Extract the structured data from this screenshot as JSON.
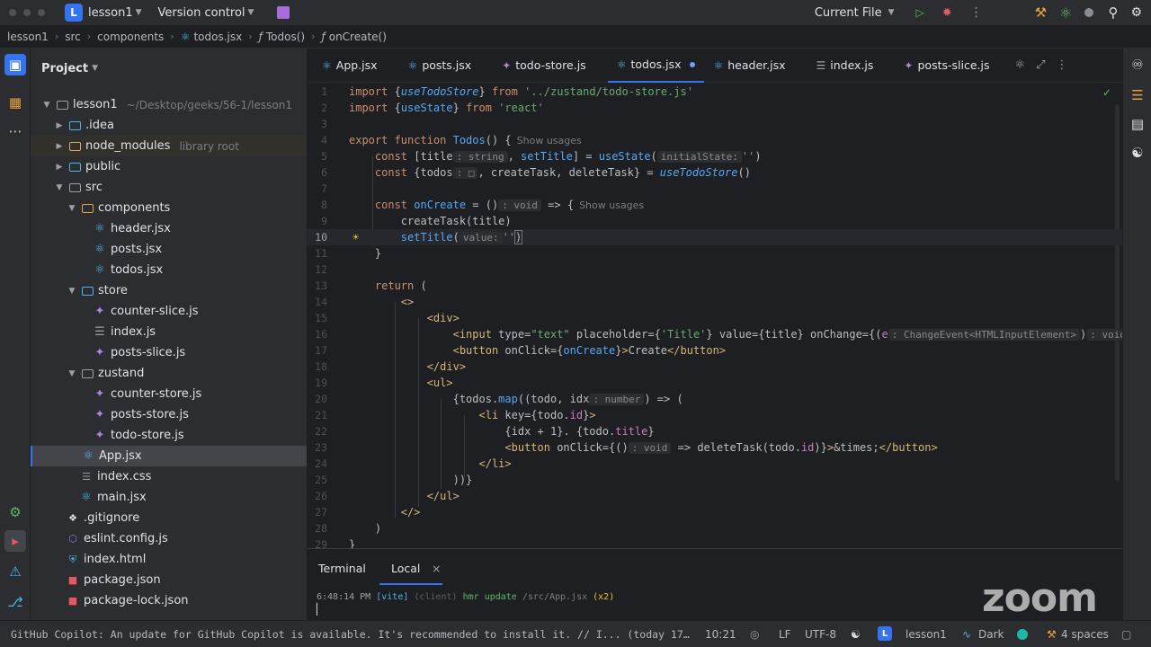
{
  "titlebar": {
    "project_badge": "L",
    "project_name": "lesson1",
    "vcs": "Version control",
    "run_config": "Current File"
  },
  "breadcrumb": [
    "lesson1",
    "src",
    "components",
    "todos.jsx",
    "Todos()",
    "onCreate()"
  ],
  "project_panel": {
    "title": "Project",
    "root": {
      "name": "lesson1",
      "path": "~/Desktop/geeks/56-1/lesson1"
    },
    "library_hint": "library root",
    "items": [
      {
        "name": ".idea"
      },
      {
        "name": "node_modules"
      },
      {
        "name": "public"
      },
      {
        "name": "src"
      },
      {
        "name": "components"
      },
      {
        "name": "header.jsx"
      },
      {
        "name": "posts.jsx"
      },
      {
        "name": "todos.jsx"
      },
      {
        "name": "store"
      },
      {
        "name": "counter-slice.js"
      },
      {
        "name": "index.js"
      },
      {
        "name": "posts-slice.js"
      },
      {
        "name": "zustand"
      },
      {
        "name": "counter-store.js"
      },
      {
        "name": "posts-store.js"
      },
      {
        "name": "todo-store.js"
      },
      {
        "name": "App.jsx"
      },
      {
        "name": "index.css"
      },
      {
        "name": "main.jsx"
      },
      {
        "name": ".gitignore"
      },
      {
        "name": "eslint.config.js"
      },
      {
        "name": "index.html"
      },
      {
        "name": "package.json"
      },
      {
        "name": "package-lock.json"
      }
    ]
  },
  "tabs": [
    "App.jsx",
    "posts.jsx",
    "todo-store.js",
    "todos.jsx",
    "header.jsx",
    "index.js",
    "posts-slice.js"
  ],
  "editor": {
    "line_numbers": [
      "1",
      "2",
      "3",
      "4",
      "5",
      "6",
      "7",
      "8",
      "9",
      "10",
      "11",
      "12",
      "13",
      "14",
      "15",
      "16",
      "17",
      "18",
      "19",
      "20",
      "21",
      "22",
      "23",
      "24",
      "25",
      "26",
      "27",
      "28",
      "29"
    ],
    "show_usages": "Show usages",
    "inlays": {
      "string": ": string",
      "initialState": "initialState:",
      "box": ": □",
      "void": ": void",
      "value": "value:",
      "change_event": ": ChangeEvent<HTMLInputElement>",
      "number": ": number"
    }
  },
  "terminal": {
    "tab_terminal": "Terminal",
    "tab_local": "Local",
    "log_time": "6:48:14 PM",
    "log_vite": "[vite]",
    "log_client": "(client)",
    "log_msg": "hmr update",
    "log_path": "/src/App.jsx",
    "log_count": "(x2)",
    "prompt": "▏"
  },
  "statusbar": {
    "message": "GitHub Copilot: An update for GitHub Copilot is available. It's recommended to install it. // I... (today 17:32)",
    "position": "10:21",
    "line_sep": "LF",
    "encoding": "UTF-8",
    "badge": "L",
    "project": "lesson1",
    "theme": "Dark",
    "indent": "4 spaces"
  },
  "watermark": "zoom"
}
